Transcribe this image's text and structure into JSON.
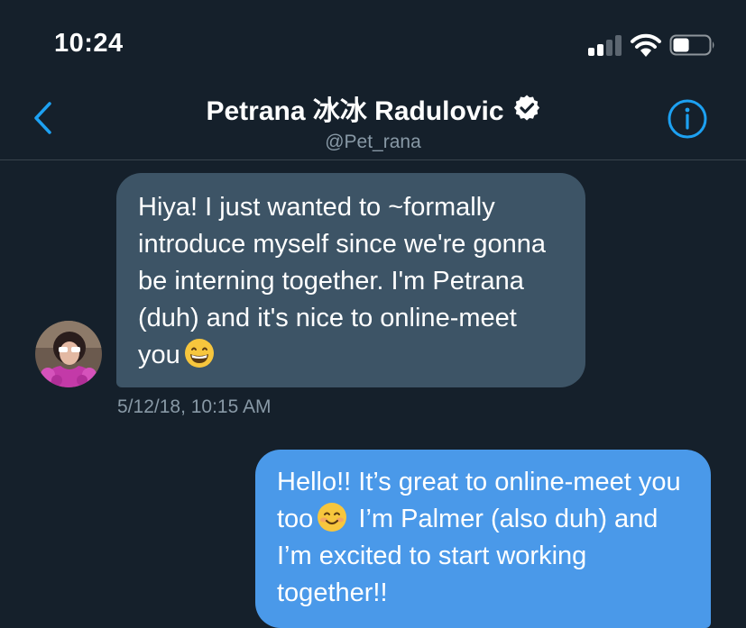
{
  "status_bar": {
    "time": "10:24",
    "signal_bars": 2,
    "battery_level_pct": 45
  },
  "header": {
    "contact_name": "Petrana 冰冰 Radulovic",
    "handle": "@Pet_rana",
    "verified": true
  },
  "messages": [
    {
      "direction": "incoming",
      "text_before_emoji": "Hiya! I just wanted to ~formally introduce myself since we're gonna be interning together. I'm Petrana (duh) and it's nice to online-meet you",
      "emoji": "grinning-face-with-smiling-eyes",
      "timestamp": "5/12/18, 10:15 AM"
    },
    {
      "direction": "outgoing",
      "text_before_emoji": "Hello!! It’s great to online-meet you too",
      "emoji": "smiling-face-with-smiling-eyes",
      "text_after_emoji": "I’m Palmer (also duh) and I’m excited to start working together!!"
    }
  ],
  "colors": {
    "background": "#15202b",
    "incoming_bubble": "#3d5466",
    "outgoing_bubble": "#4a99e9",
    "accent": "#1da1f2",
    "muted_text": "#8899a6"
  }
}
